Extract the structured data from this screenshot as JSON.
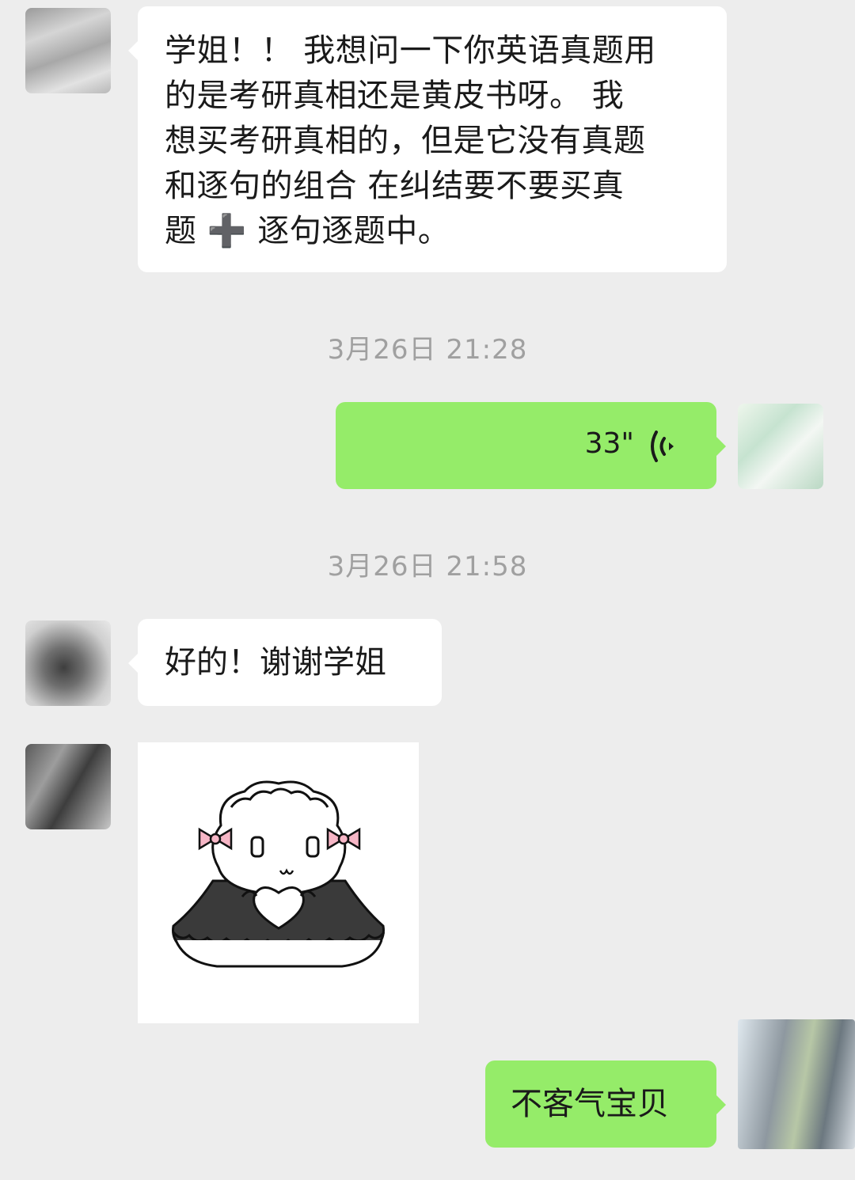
{
  "messages": [
    {
      "side": "left",
      "type": "text",
      "lines": [
        "学姐！！ 我想问一下你英语真题用",
        "的是考研真相还是黄皮书呀。 我",
        "想买考研真相的，但是它没有真题",
        "和逐句的组合 在纠结要不要买真",
        "题 ➕ 逐句逐题中。"
      ]
    },
    {
      "side": "right",
      "type": "voice",
      "duration": "33\"",
      "icon": "voice-wave-icon"
    },
    {
      "side": "left",
      "type": "text",
      "text": "好的！谢谢学姐"
    },
    {
      "side": "left",
      "type": "sticker",
      "icon": "maid-sheep-sticker"
    },
    {
      "side": "right",
      "type": "text",
      "text": "不客气宝贝"
    }
  ],
  "timestamps": [
    "3月26日 21:28",
    "3月26日 21:58"
  ],
  "colors": {
    "background": "#ededed",
    "bubble_incoming": "#ffffff",
    "bubble_outgoing": "#95ec69",
    "timestamp": "#a0a0a0"
  }
}
